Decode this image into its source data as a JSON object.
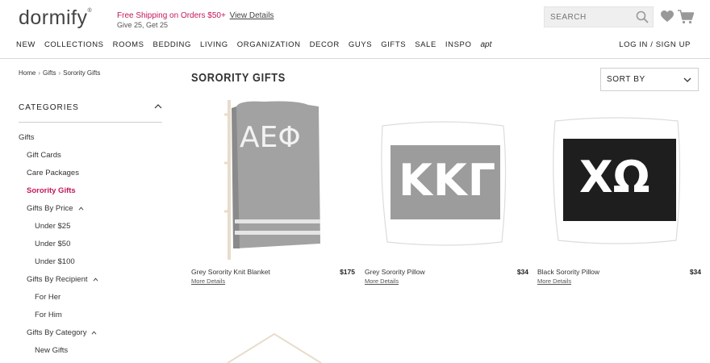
{
  "header": {
    "logo": "dormify",
    "promo_text": "Free Shipping on Orders $50+",
    "promo_link": "View Details",
    "promo_sub": "Give 25, Get 25",
    "search_placeholder": "SEARCH",
    "login": "LOG IN / SIGN UP"
  },
  "nav": [
    "NEW",
    "COLLECTIONS",
    "ROOMS",
    "BEDDING",
    "LIVING",
    "ORGANIZATION",
    "DECOR",
    "GUYS",
    "GIFTS",
    "SALE",
    "INSPO",
    "apt"
  ],
  "breadcrumb": [
    "Home",
    "Gifts",
    "Sorority Gifts"
  ],
  "sidebar": {
    "heading": "CATEGORIES",
    "items": [
      {
        "label": "Gifts"
      },
      {
        "label": "Gift Cards"
      },
      {
        "label": "Care Packages"
      },
      {
        "label": "Sorority Gifts"
      },
      {
        "label": "Gifts By Price"
      },
      {
        "label": "Under $25"
      },
      {
        "label": "Under $50"
      },
      {
        "label": "Under $100"
      },
      {
        "label": "Gifts By Recipient"
      },
      {
        "label": "For Her"
      },
      {
        "label": "For Him"
      },
      {
        "label": "Gifts By Category"
      },
      {
        "label": "New Gifts"
      }
    ]
  },
  "main": {
    "title": "SORORITY GIFTS",
    "sort_label": "SORT BY",
    "products": [
      {
        "name": "Grey Sorority Knit Blanket",
        "price": "$175",
        "more": "More Details",
        "letters": "ΑΕΦ"
      },
      {
        "name": "Grey Sorority Pillow",
        "price": "$34",
        "more": "More Details",
        "letters": "ΚΚΓ"
      },
      {
        "name": "Black Sorority Pillow",
        "price": "$34",
        "more": "More Details",
        "letters": "ΧΩ"
      }
    ]
  },
  "colors": {
    "accent": "#c2185b",
    "grey_fabric": "#9a9a9a",
    "black_fabric": "#1e1e1e"
  }
}
